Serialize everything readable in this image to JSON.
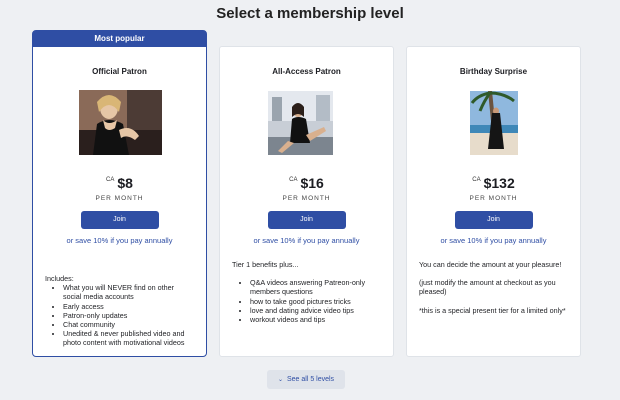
{
  "page": {
    "title": "Select a membership level"
  },
  "tiers": [
    {
      "badge": "Most popular",
      "name": "Official Patron",
      "currency": "CA",
      "price": "$8",
      "period": "PER MONTH",
      "join_label": "Join",
      "save_text": "or save 10% if you pay annually",
      "intro": "Includes:",
      "benefits": [
        "What you will NEVER find on other social media accounts",
        "Early access",
        "Patron-only updates",
        "Chat community",
        "Unedited & never published video and photo content with motivational videos"
      ]
    },
    {
      "name": "All-Access Patron",
      "currency": "CA",
      "price": "$16",
      "period": "PER MONTH",
      "join_label": "Join",
      "save_text": "or save 10% if you pay annually",
      "intro": "Tier 1 benefits plus...",
      "benefits": [
        "Q&A videos answering Patreon-only members questions",
        "how to take good pictures tricks",
        "love and dating advice video tips",
        "workout videos and tips"
      ]
    },
    {
      "name": "Birthday Surprise",
      "currency": "CA",
      "price": "$132",
      "period": "PER MONTH",
      "join_label": "Join",
      "save_text": "or save 10% if you pay annually",
      "paragraphs": [
        "You can decide the amount at your pleasure!",
        "(just modify the amount at checkout as you pleased)",
        "*this is a special present tier for a limited only*"
      ]
    }
  ],
  "footer": {
    "see_all_label": "See all 5 levels",
    "chevron_icon": "chevron-down-icon"
  },
  "colors": {
    "accent": "#2f4ea4",
    "background": "#eef0f3",
    "card": "#ffffff"
  }
}
